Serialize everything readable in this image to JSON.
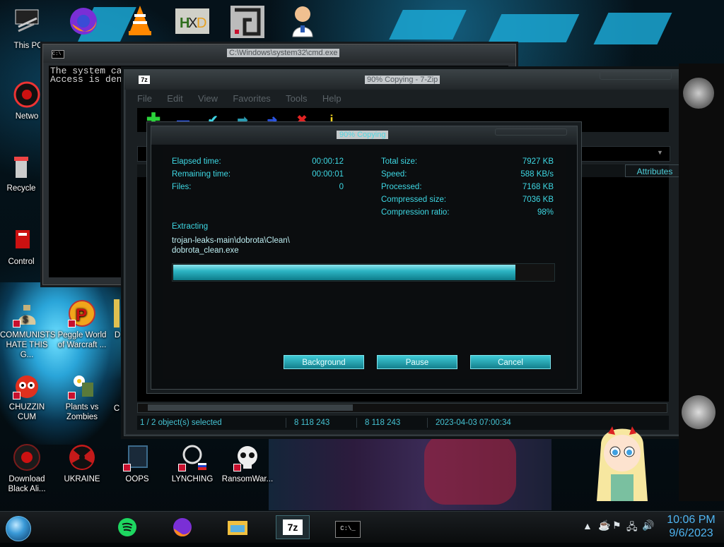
{
  "desktop": {
    "icons": [
      {
        "label": "This PC",
        "icon": "computer-icon"
      },
      {
        "label": "Netwo",
        "icon": "network-icon"
      },
      {
        "label": "Recycle",
        "icon": "recycle-bin-icon"
      },
      {
        "label": "Control",
        "icon": "control-panel-icon"
      },
      {
        "label": "COMMUNISTS HATE THIS G...",
        "icon": "money-bag-icon"
      },
      {
        "label": "Peggle World of Warcraft ...",
        "icon": "peggle-icon"
      },
      {
        "label": "CHUZZIN CUM",
        "icon": "chuzzle-icon"
      },
      {
        "label": "Plants vs Zombies",
        "icon": "plants-vs-zombies-icon"
      },
      {
        "label": "Download Black Ali...",
        "icon": "alien-icon"
      },
      {
        "label": "UKRAINE",
        "icon": "radiation-icon"
      },
      {
        "label": "OOPS",
        "icon": "oops-icon"
      },
      {
        "label": "LYNCHING",
        "icon": "lynching-icon"
      },
      {
        "label": "RansomWar...",
        "icon": "skull-icon"
      },
      {
        "label": "D",
        "icon": "unknown-icon"
      },
      {
        "label": "C",
        "icon": "unknown-icon"
      }
    ],
    "top_row_icons": [
      "computer-icon",
      "firefox-icon",
      "vlc-icon",
      "hxd-icon",
      "maze-icon",
      "doctor-icon"
    ]
  },
  "cmd_window": {
    "title": "C:\\Windows\\system32\\cmd.exe",
    "lines": [
      "The system ca",
      "Access is den"
    ]
  },
  "zip_window": {
    "title": "90% Copying - 7-Zip",
    "menu": [
      "File",
      "Edit",
      "View",
      "Favorites",
      "Tools",
      "Help"
    ],
    "column_attributes": "Attributes",
    "status": {
      "selected": "1 / 2 object(s) selected",
      "size": "8 118 243",
      "packed": "8 118 243",
      "modified": "2023-04-03 07:00:34"
    }
  },
  "progress_dialog": {
    "title": "90% Copying",
    "elapsed_label": "Elapsed time:",
    "elapsed_value": "00:00:12",
    "remaining_label": "Remaining time:",
    "remaining_value": "00:00:01",
    "files_label": "Files:",
    "files_value": "0",
    "total_size_label": "Total size:",
    "total_size_value": "7927 KB",
    "speed_label": "Speed:",
    "speed_value": "588 KB/s",
    "processed_label": "Processed:",
    "processed_value": "7168 KB",
    "compressed_label": "Compressed size:",
    "compressed_value": "7036 KB",
    "ratio_label": "Compression ratio:",
    "ratio_value": "98%",
    "operation": "Extracting",
    "path_line1": "trojan-leaks-main\\dobrota\\Clean\\",
    "path_line2": "dobrota_clean.exe",
    "progress_fraction": 0.9,
    "buttons": {
      "background": "Background",
      "pause": "Pause",
      "cancel": "Cancel"
    }
  },
  "taskbar": {
    "items": [
      "spotify-icon",
      "firefox-icon",
      "file-explorer-icon",
      "7zip-icon",
      "cmd-icon"
    ],
    "active_item": "7zip-icon",
    "cmd_glyph": "C:\\_",
    "clock_time": "10:06 PM",
    "clock_date": "9/6/2023"
  },
  "colors": {
    "accent": "#3ed8e4",
    "clock": "#4fb5f2"
  }
}
